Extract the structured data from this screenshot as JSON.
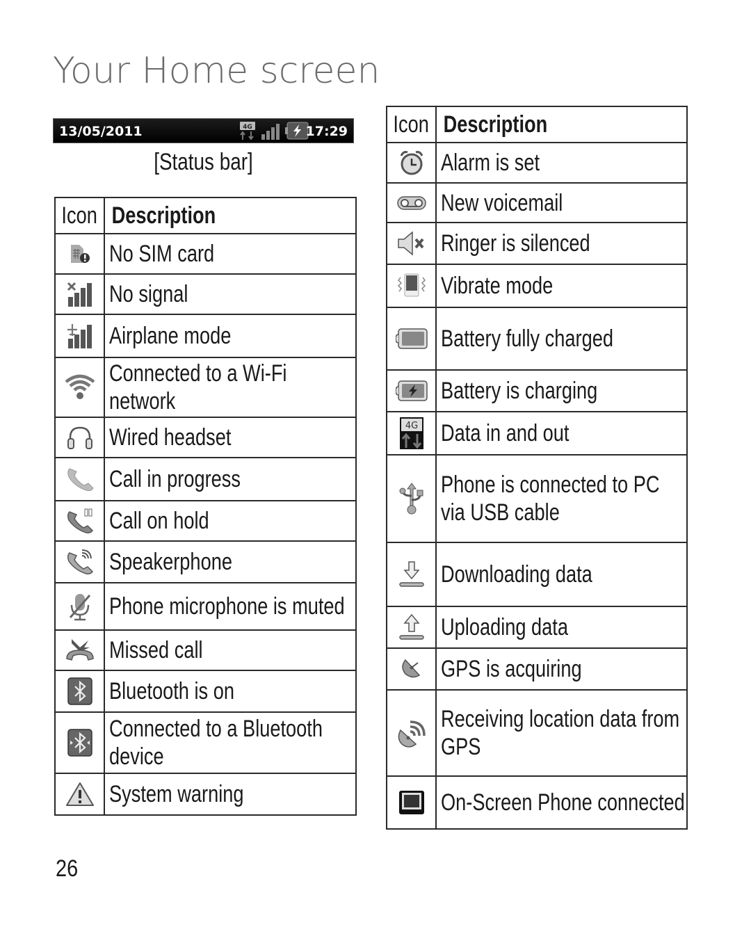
{
  "page": {
    "title": "Your Home screen",
    "page_number": "26"
  },
  "status_bar": {
    "date": "13/05/2011",
    "time": "17:29",
    "network_label": "4G",
    "caption": "[Status bar]",
    "icons": [
      "data-4g-icon",
      "signal-bars-icon",
      "battery-charging-icon"
    ]
  },
  "left_table": {
    "headers": {
      "icon": "Icon",
      "description": "Description"
    },
    "rows": [
      {
        "icon": "no-sim-card-icon",
        "description": "No SIM card"
      },
      {
        "icon": "no-signal-icon",
        "description": "No signal"
      },
      {
        "icon": "airplane-mode-icon",
        "description": "Airplane mode"
      },
      {
        "icon": "wifi-icon",
        "description": "Connected to a Wi-Fi network"
      },
      {
        "icon": "headset-icon",
        "description": "Wired headset"
      },
      {
        "icon": "call-in-progress-icon",
        "description": "Call in progress"
      },
      {
        "icon": "call-on-hold-icon",
        "description": "Call on hold"
      },
      {
        "icon": "speakerphone-icon",
        "description": "Speakerphone"
      },
      {
        "icon": "mic-muted-icon",
        "description": "Phone microphone is muted"
      },
      {
        "icon": "missed-call-icon",
        "description": "Missed call"
      },
      {
        "icon": "bluetooth-on-icon",
        "description": "Bluetooth is on"
      },
      {
        "icon": "bluetooth-connected-icon",
        "description": "Connected to a Bluetooth device"
      },
      {
        "icon": "system-warning-icon",
        "description": "System warning"
      }
    ]
  },
  "right_table": {
    "headers": {
      "icon": "Icon",
      "description": "Description"
    },
    "rows": [
      {
        "icon": "alarm-icon",
        "description": "Alarm is set"
      },
      {
        "icon": "voicemail-icon",
        "description": "New voicemail"
      },
      {
        "icon": "ringer-silenced-icon",
        "description": "Ringer is silenced"
      },
      {
        "icon": "vibrate-icon",
        "description": "Vibrate mode"
      },
      {
        "icon": "battery-full-icon",
        "description": "Battery fully charged"
      },
      {
        "icon": "battery-charging-icon",
        "description": "Battery is charging"
      },
      {
        "icon": "data-in-out-icon",
        "description": "Data in and out",
        "label": "4G"
      },
      {
        "icon": "usb-icon",
        "description": "Phone is connected to PC via USB cable"
      },
      {
        "icon": "download-icon",
        "description": "Downloading data"
      },
      {
        "icon": "upload-icon",
        "description": "Uploading data"
      },
      {
        "icon": "gps-acquiring-icon",
        "description": "GPS is acquiring"
      },
      {
        "icon": "gps-receiving-icon",
        "description": "Receiving location data from GPS"
      },
      {
        "icon": "on-screen-phone-icon",
        "description": "On-Screen Phone connected"
      }
    ]
  }
}
